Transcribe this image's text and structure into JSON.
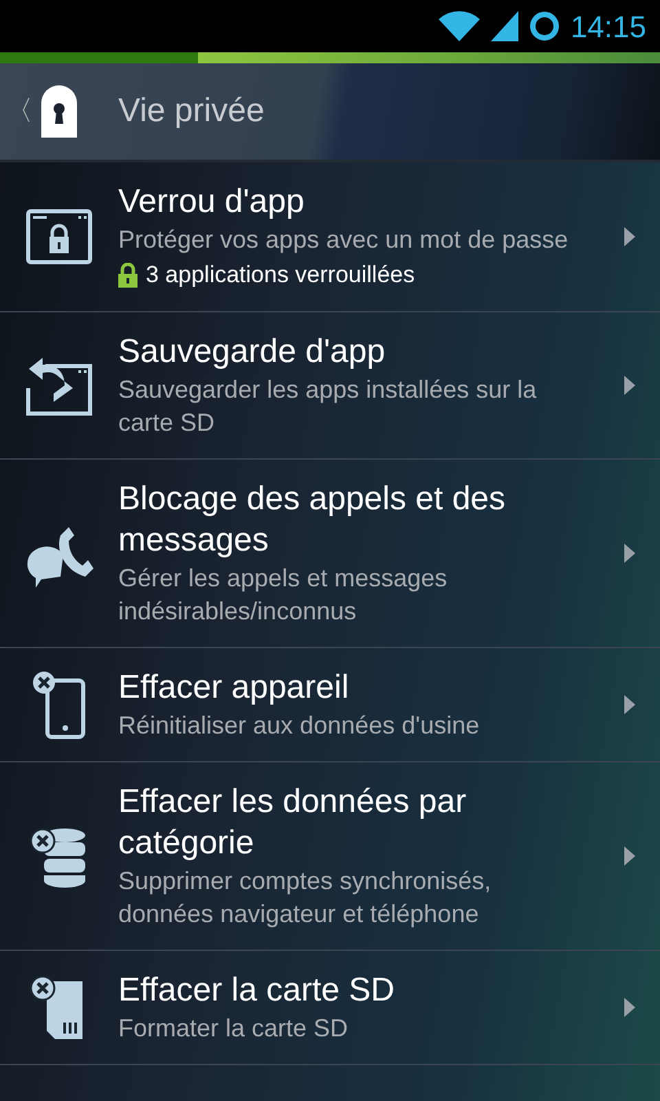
{
  "status_bar": {
    "time": "14:15"
  },
  "app_bar": {
    "back": "〈",
    "title": "Vie privée"
  },
  "items": [
    {
      "title": "Verrou d'app",
      "subtitle": "Protéger vos apps avec un mot de passe",
      "note": "3 applications verrouillées"
    },
    {
      "title": "Sauvegarde d'app",
      "subtitle": "Sauvegarder les apps installées sur la carte SD"
    },
    {
      "title": "Blocage des appels et des messages",
      "subtitle": "Gérer les appels et messages indésirables/inconnus"
    },
    {
      "title": "Effacer appareil",
      "subtitle": "Réinitialiser aux données d'usine"
    },
    {
      "title": "Effacer les données par catégorie",
      "subtitle": "Supprimer comptes synchronisés, données navigateur et téléphone"
    },
    {
      "title": "Effacer la carte SD",
      "subtitle": "Formater la carte SD"
    }
  ]
}
